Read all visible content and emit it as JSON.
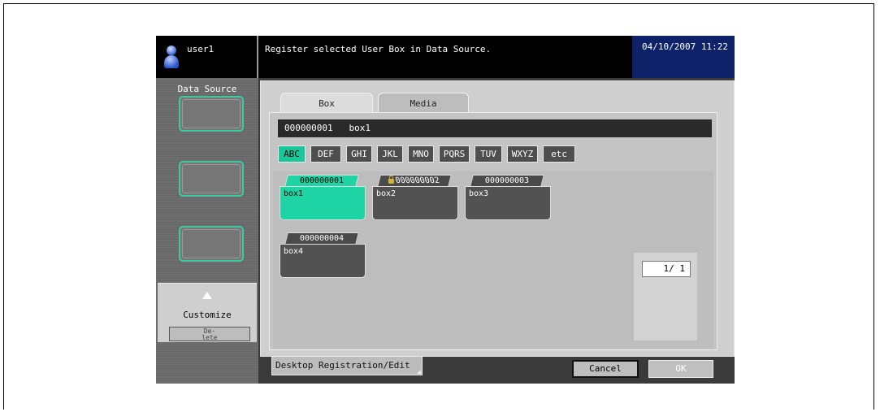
{
  "header": {
    "user": "user1",
    "message": "Register selected User Box in Data Source.",
    "datetime": "04/10/2007 11:22"
  },
  "left_panel": {
    "title": "Data Source",
    "customize_label": "Customize",
    "delete_label_line1": "De-",
    "delete_label_line2": "lete"
  },
  "tabs": [
    "Box",
    "Media"
  ],
  "selected_box_display": {
    "number": "000000001",
    "name": "box1"
  },
  "index_buttons": [
    "ABC",
    "DEF",
    "GHI",
    "JKL",
    "MNO",
    "PQRS",
    "TUV",
    "WXYZ",
    "etc"
  ],
  "boxes": [
    {
      "number": "000000001",
      "name": "box1",
      "selected": true,
      "locked": false
    },
    {
      "number": "000000002",
      "name": "box2",
      "selected": false,
      "locked": true
    },
    {
      "number": "000000003",
      "name": "box3",
      "selected": false,
      "locked": false
    },
    {
      "number": "000000004",
      "name": "box4",
      "selected": false,
      "locked": false
    }
  ],
  "pager": "1/  1",
  "footer": {
    "desktop_button": "Desktop Registration/Edit",
    "cancel": "Cancel",
    "ok": "OK"
  },
  "colors": {
    "accent": "#18c79a",
    "header_date_bg": "#0d2268"
  }
}
